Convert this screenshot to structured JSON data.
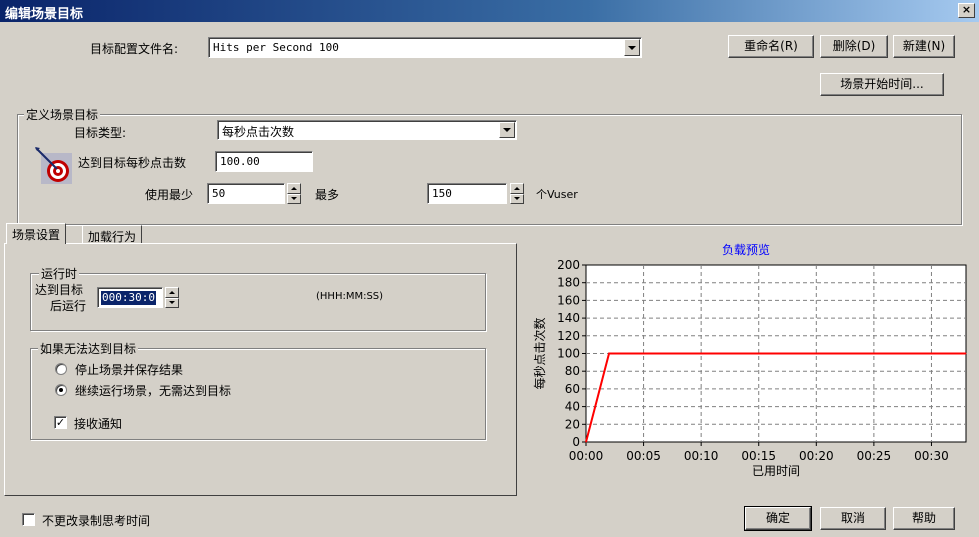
{
  "window": {
    "title": "编辑场景目标",
    "close_glyph": "×"
  },
  "profile": {
    "label": "目标配置文件名:",
    "value": "Hits per Second 100"
  },
  "buttons": {
    "rename": "重命名(R)",
    "delete": "删除(D)",
    "new": "新建(N)",
    "start_time": "场景开始时间...",
    "ok": "确定",
    "cancel": "取消",
    "help": "帮助"
  },
  "define_group": {
    "title": "定义场景目标",
    "type_label": "目标类型:",
    "type_value": "每秒点击次数",
    "target_label": "达到目标每秒点击数",
    "target_value": "100.00",
    "min_label": "使用最少",
    "min_value": "50",
    "max_label": "最多",
    "max_value": "150",
    "unit_label": "个Vuser",
    "target_icon": "dart-target-icon"
  },
  "tabs": [
    {
      "label": "场景设置",
      "active": true
    },
    {
      "label": "加载行为",
      "active": false
    }
  ],
  "runtime_group": {
    "title": "运行时",
    "label_line1": "达到目标",
    "label_line2": "后运行",
    "time_value": "000:30:0",
    "format_hint": "(HHH:MM:SS)"
  },
  "fail_group": {
    "title": "如果无法达到目标",
    "options": [
      {
        "label": "停止场景并保存结果",
        "selected": false
      },
      {
        "label": "继续运行场景，无需达到目标",
        "selected": true
      }
    ],
    "notify_label": "接收通知",
    "notify_checked": true
  },
  "footer": {
    "think_time_label": "不更改录制思考时间",
    "think_time_checked": false
  },
  "chart_data": {
    "type": "line",
    "title": "负载预览",
    "xlabel": "已用时间",
    "ylabel": "每秒点击次数",
    "x_ticks": [
      "00:00",
      "00:05",
      "00:10",
      "00:15",
      "00:20",
      "00:25",
      "00:30"
    ],
    "y_ticks": [
      0,
      20,
      40,
      60,
      80,
      100,
      120,
      140,
      160,
      180,
      200
    ],
    "ylim": [
      0,
      200
    ],
    "xlim_minutes": [
      0,
      33
    ],
    "grid": true,
    "series": [
      {
        "color": "#ff0000",
        "points": [
          {
            "x": "00:00",
            "y": 0
          },
          {
            "x": "00:02",
            "y": 100
          },
          {
            "x": "00:33",
            "y": 100
          }
        ]
      }
    ]
  }
}
